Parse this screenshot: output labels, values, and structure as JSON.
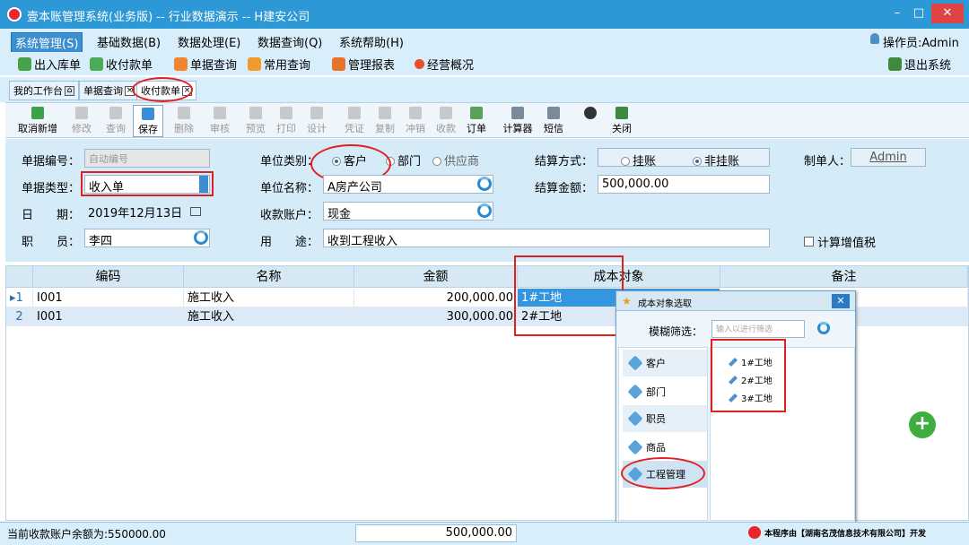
{
  "window": {
    "title": "壹本账管理系统(业务版) -- 行业数据演示 -- H建安公司",
    "min_icon": "minimize-icon",
    "max_icon": "maximize-icon",
    "close_icon": "close-icon"
  },
  "menubar": {
    "items": [
      "系统管理(S)",
      "基础数据(B)",
      "数据处理(E)",
      "数据查询(Q)",
      "系统帮助(H)"
    ],
    "operator": "操作员:Admin"
  },
  "quickbar": {
    "items": [
      "出入库单",
      "收付款单",
      "单据查询",
      "常用查询",
      "管理报表",
      "经营概况"
    ],
    "exit": "退出系统"
  },
  "tabs": [
    "我的工作台",
    "单据查询",
    "收付款单"
  ],
  "toolbar": {
    "buttons": [
      "取消新增",
      "修改",
      "查询",
      "保存",
      "删除",
      "审核",
      "预览",
      "打印",
      "设计",
      "凭证",
      "复制",
      "冲销",
      "收款",
      "订单",
      "计算器",
      "短信",
      "关闭"
    ]
  },
  "form": {
    "doc_no_label": "单据编号：",
    "doc_no_placeholder": "自动编号",
    "doc_type_label": "单据类型：",
    "doc_type_value": "收入单",
    "date_label": "日　　期：",
    "date_value": "2019年12月13日",
    "staff_label": "职　　员：",
    "staff_value": "李四",
    "unit_type_label": "单位类别：",
    "unit_type_options": [
      "客户",
      "部门",
      "供应商"
    ],
    "unit_type_selected": "客户",
    "unit_name_label": "单位名称：",
    "unit_name_value": "A房产公司",
    "account_label": "收款账户：",
    "account_value": "现金",
    "purpose_label": "用　　途：",
    "purpose_value": "收到工程收入",
    "settle_label": "结算方式：",
    "settle_options": [
      "挂账",
      "非挂账"
    ],
    "settle_selected": "非挂账",
    "amount_label": "结算金额：",
    "amount_value": "500,000.00",
    "maker_label": "制单人：",
    "maker_value": "Admin",
    "vat_label": "计算增值税"
  },
  "grid": {
    "columns": [
      "编码",
      "名称",
      "金额",
      "成本对象",
      "备注"
    ],
    "rows": [
      {
        "no": "1",
        "code": "I001",
        "name": "施工收入",
        "amount": "200,000.00",
        "cost_obj": "1#工地",
        "remark": ""
      },
      {
        "no": "2",
        "code": "I001",
        "name": "施工收入",
        "amount": "300,000.00",
        "cost_obj": "2#工地",
        "remark": ""
      }
    ]
  },
  "popup": {
    "title": "成本对象选取",
    "filter_label": "模糊筛选：",
    "filter_placeholder": "输入以进行筛选",
    "categories": [
      "客户",
      "部门",
      "职员",
      "商品",
      "工程管理"
    ],
    "nodes": [
      "1#工地",
      "2#工地",
      "3#工地"
    ]
  },
  "status": {
    "balance": "当前收款账户余额为:550000.00",
    "total": "500,000.00",
    "vendor": "本程序由【湖南名茂信息技术有限公司】开发"
  },
  "colors": {
    "title_bar": "#2d98d6",
    "panel": "#d6ebf8",
    "annotation": "#e02020"
  }
}
